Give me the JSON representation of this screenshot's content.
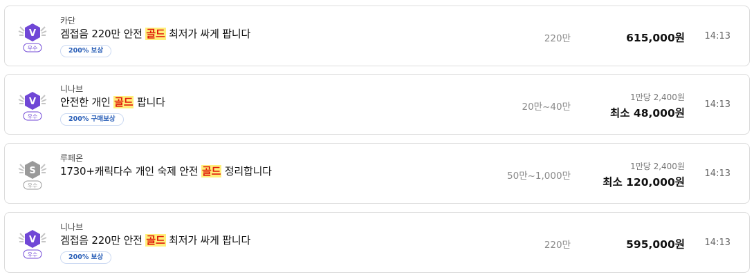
{
  "listings": [
    {
      "server": "카단",
      "title_before": "겜접음 220만 안전 ",
      "title_highlight": "골드",
      "title_after": " 최저가 싸게 팝니다",
      "tag": "200% 보상",
      "amount": "220만",
      "unit_price": "",
      "price": "615,000원",
      "time": "14:13",
      "badge_letter": "V",
      "badge_grade": "우수",
      "badge_color": "#7047d6"
    },
    {
      "server": "니나브",
      "title_before": "안전한 개인 ",
      "title_highlight": "골드",
      "title_after": " 팝니다",
      "tag": "200% 구매보상",
      "amount": "20만~40만",
      "unit_price": "1만당 2,400원",
      "price": "최소 48,000원",
      "time": "14:13",
      "badge_letter": "V",
      "badge_grade": "우수",
      "badge_color": "#7047d6"
    },
    {
      "server": "루페온",
      "title_before": "1730+캐릭다수 개인 숙제 안전 ",
      "title_highlight": "골드",
      "title_after": " 정리합니다",
      "tag": "",
      "amount": "50만~1,000만",
      "unit_price": "1만당 2,400원",
      "price": "최소 120,000원",
      "time": "14:13",
      "badge_letter": "S",
      "badge_grade": "우수",
      "badge_color": "#9a9a9a"
    },
    {
      "server": "니나브",
      "title_before": "겜접음 220만 안전 ",
      "title_highlight": "골드",
      "title_after": " 최저가 싸게 팝니다",
      "tag": "200% 보상",
      "amount": "220만",
      "unit_price": "",
      "price": "595,000원",
      "time": "14:13",
      "badge_letter": "V",
      "badge_grade": "우수",
      "badge_color": "#7047d6"
    }
  ]
}
